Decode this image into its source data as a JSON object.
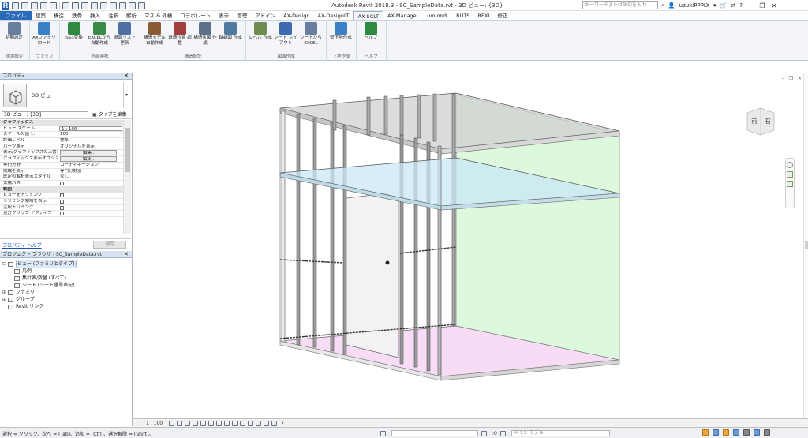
{
  "app": {
    "window_title": "Autodesk Revit 2018.3 -   SC_SampleData.rvt - 3D ビュー: {3D}",
    "search_placeholder": "キーワードまたは語句を入力",
    "user": "uzukiPPPLY"
  },
  "menu": {
    "tabs": [
      "ファイル",
      "建築",
      "構造",
      "鉄骨",
      "挿入",
      "注釈",
      "解析",
      "マス & 外構",
      "コラボレート",
      "表示",
      "管理",
      "アドイン",
      "AX-Design",
      "AX-DesignLT",
      "AX-SCLT",
      "AX-Manage",
      "Lumion®",
      "RUTS",
      "REXI",
      "修正"
    ],
    "active": "AX-SCLT"
  },
  "ribbon": {
    "groups": [
      {
        "label": "環境設定",
        "buttons": [
          "初期設定"
        ]
      },
      {
        "label": "ファミリ",
        "buttons": [
          "AXファミリ ロード"
        ]
      },
      {
        "label": "外部連携",
        "buttons": [
          "SS3変換",
          "EXCELから 自動作成",
          "断面リスト 更新"
        ]
      },
      {
        "label": "構造設計",
        "buttons": [
          "構造モデル 自動作成",
          "鉄筋位置 調整",
          "構造伏図 作成",
          "軸組図 作成"
        ]
      },
      {
        "label": "図面作成",
        "buttons": [
          "レベル 作成",
          "シート レイアウト",
          "シートから EXCEL"
        ]
      },
      {
        "label": "下地作成",
        "buttons": [
          "壁下地作成"
        ]
      },
      {
        "label": "ヘルプ",
        "buttons": [
          "ヘルプ"
        ]
      }
    ]
  },
  "properties": {
    "title": "プロパティ",
    "type_name": "3D ビュー",
    "instance": "3D ビュー: {3D}",
    "edit_type": "タイプを編集",
    "rows": [
      {
        "k": "グラフィックス",
        "cat": true
      },
      {
        "k": "ビュー スケール",
        "v": "1 : 100",
        "box": true
      },
      {
        "k": "スケールの値    1:",
        "v": "100"
      },
      {
        "k": "詳細レベル",
        "v": "標準"
      },
      {
        "k": "パーツ表示",
        "v": "オリジナルを表示"
      },
      {
        "k": "表示/グラフィックスの上書き",
        "v": "編集...",
        "btn": true
      },
      {
        "k": "グラフィックス表示オプション",
        "v": "編集...",
        "btn": true
      },
      {
        "k": "専門分野",
        "v": "コーディネーション"
      },
      {
        "k": "隠線を表示",
        "v": "専門分野別"
      },
      {
        "k": "既定の解析表示スタイル",
        "v": "なし"
      },
      {
        "k": "太陽パス",
        "v": "",
        "chk": true
      },
      {
        "k": "範囲",
        "cat": true
      },
      {
        "k": "ビューをトリミング",
        "v": "",
        "chk": true
      },
      {
        "k": "トリミング領域を表示",
        "v": "",
        "chk": true
      },
      {
        "k": "注釈トリミング",
        "v": "",
        "chk": true
      },
      {
        "k": "遠方クリップ アクティブ",
        "v": "",
        "chk": true
      }
    ],
    "help_link": "プロパティ ヘルプ",
    "apply": "適用"
  },
  "browser": {
    "title": "プロジェクト ブラウザ - SC_SampleData.rvt",
    "items": [
      {
        "label": "ビュー (ファミリとタイプ)",
        "tw": "⊟",
        "sel": true,
        "indent": 0
      },
      {
        "label": "凡例",
        "tw": "",
        "indent": 1
      },
      {
        "label": "集計表/数量 (すべて)",
        "tw": "",
        "indent": 1
      },
      {
        "label": "シート (シート番号表記)",
        "tw": "",
        "indent": 1
      },
      {
        "label": "ファミリ",
        "tw": "⊞",
        "indent": 0
      },
      {
        "label": "グループ",
        "tw": "⊞",
        "indent": 0
      },
      {
        "label": "Revit リンク",
        "tw": "",
        "indent": 0
      }
    ]
  },
  "viewcube": {
    "left": "前",
    "right": "右"
  },
  "viewbar": {
    "scale": "1 : 100"
  },
  "status": {
    "message": "選択 = クリック、次へ = [Tab]、追加 = [Ctrl]、選択解除 = [Shift]。",
    "zero": ":0",
    "model": "メイン モデル"
  }
}
